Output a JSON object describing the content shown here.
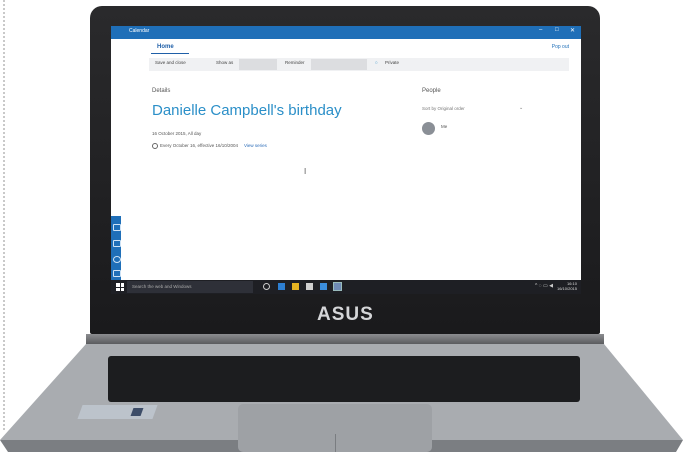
{
  "window": {
    "title": "Calendar",
    "controls": [
      "–",
      "□",
      "✕"
    ]
  },
  "ribbon": {
    "tab": "Home",
    "popout": "Pop out",
    "toolbar": {
      "show_as_label": "Show as",
      "reminder_label": "Reminder",
      "private_label": "Private",
      "save_label": "Save and close",
      "people_icon": "people-icon"
    }
  },
  "details": {
    "heading": "Details",
    "event_title": "Danielle Campbell's birthday",
    "date_line": "16 October 2015, All day",
    "repeat_text": "Every October 16, effective 16/10/2004",
    "view_series_link": "View series"
  },
  "people": {
    "heading": "People",
    "sort_by": "Sort by  Original order",
    "me_label": "Me"
  },
  "taskbar": {
    "search_placeholder": "Search the web and Windows",
    "time": "16:10",
    "date": "16/10/2015"
  },
  "laptop": {
    "brand": "ASUS"
  },
  "colors": {
    "accent": "#1f6fb8",
    "title_text": "#2b8fc8",
    "taskbar": "#1e1f24",
    "bezel": "#1e1e20"
  }
}
